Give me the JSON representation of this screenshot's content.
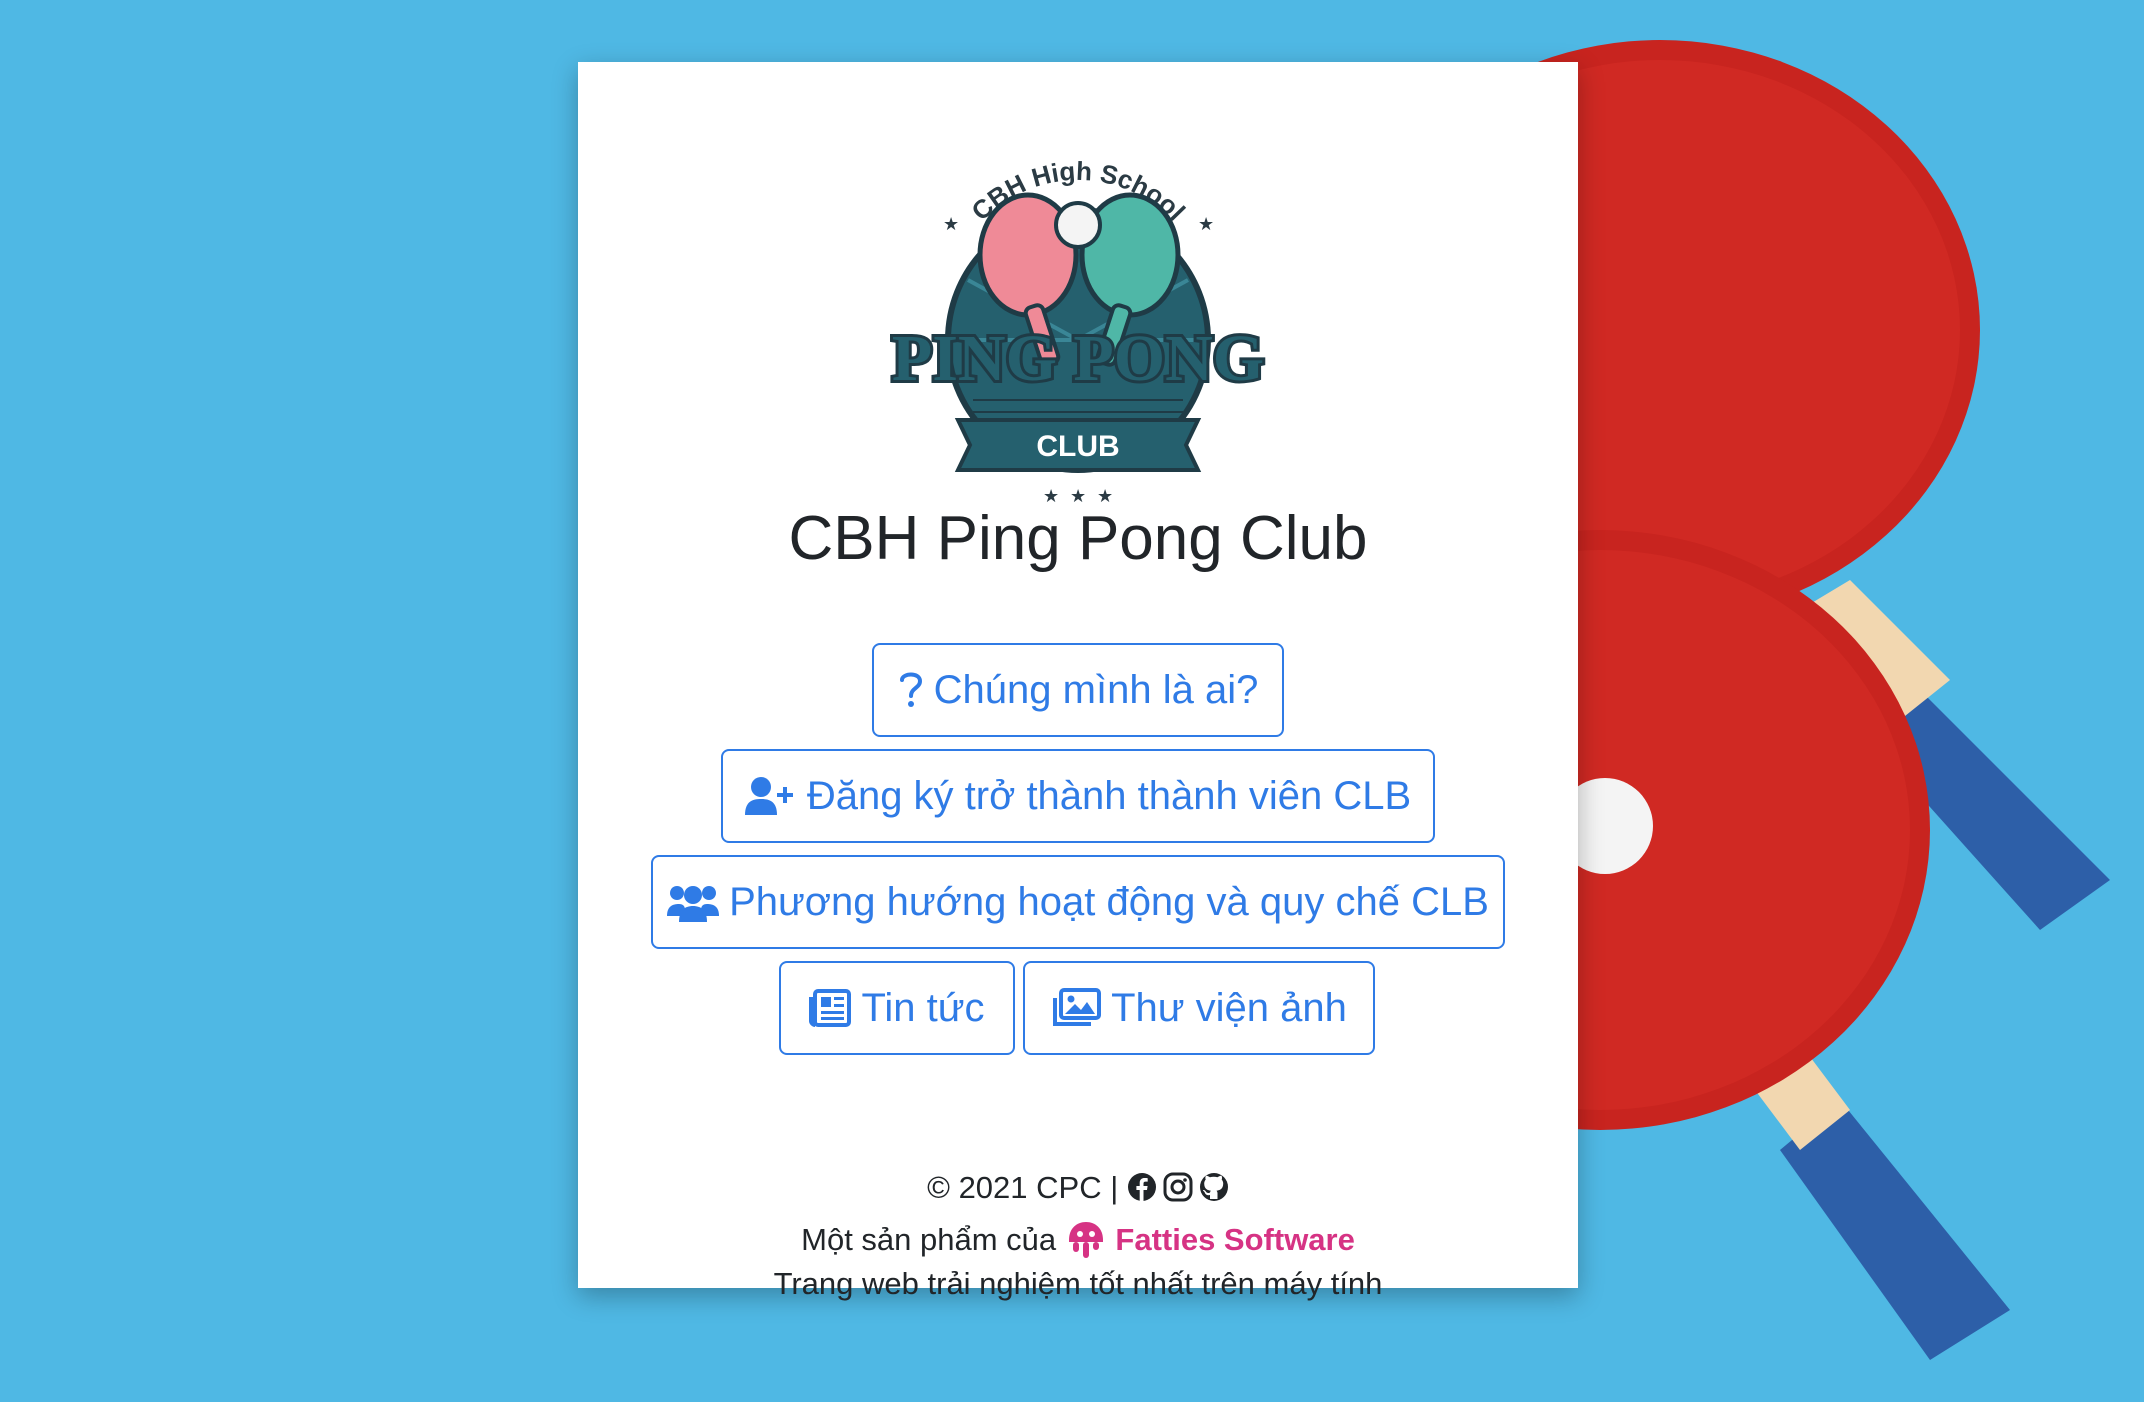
{
  "logo": {
    "arc_text": "CBH High School",
    "main_text": "PING PONG",
    "ribbon_text": "CLUB"
  },
  "title": "CBH Ping Pong Club",
  "buttons": {
    "who": {
      "label": "Chúng mình là ai?",
      "icon": "question-icon"
    },
    "register": {
      "label": "Đăng ký trở thành thành viên CLB",
      "icon": "user-plus-icon"
    },
    "direction": {
      "label": "Phương hướng hoạt động và quy chế CLB",
      "icon": "users-icon"
    },
    "news": {
      "label": "Tin tức",
      "icon": "newspaper-icon"
    },
    "gallery": {
      "label": "Thư viện ảnh",
      "icon": "photo-gallery-icon"
    }
  },
  "footer": {
    "copyright": "© 2021 CPC |",
    "product_prefix": "Một sản phẩm của",
    "brand": "Fatties Software",
    "note": "Trang web trải nghiệm tốt nhất trên máy tính"
  },
  "colors": {
    "accent": "#2f7be6",
    "brand": "#d63384",
    "background": "#4fb8e4"
  }
}
